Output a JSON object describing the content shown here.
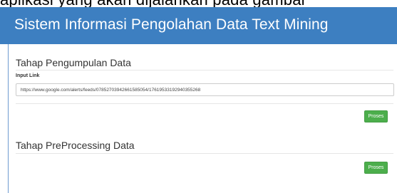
{
  "top_strip_text": "aplikasi yang akan dijalankan pada gambar",
  "header": {
    "title": "Sistem Informasi Pengolahan Data Text Mining"
  },
  "collection": {
    "title": "Tahap Pengumpulan Data",
    "input_label": "Input Link",
    "input_value": "https://www.google.com/alerts/feeds/07852703942661585054/17619533192940355268",
    "button_label": "Proses"
  },
  "preprocessing": {
    "title": "Tahap PreProcessing Data",
    "button_label": "Proses"
  },
  "colors": {
    "header": "#3d7fc1",
    "button": "#4cae4c"
  }
}
